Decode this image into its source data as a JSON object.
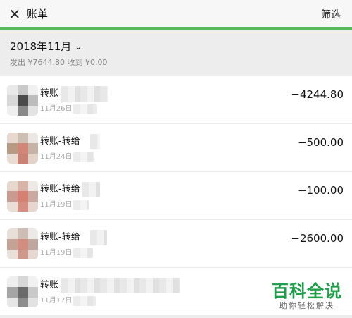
{
  "header": {
    "close_icon": "close-icon",
    "title": "账单",
    "filter_label": "筛选"
  },
  "summary": {
    "month": "2018年11月",
    "dropdown_icon": "chevron-down-icon",
    "totals": "发出 ¥7644.80 收到 ¥0.00"
  },
  "transactions": [
    {
      "name": "转账",
      "date": "11月26日",
      "amount": "−4244.80"
    },
    {
      "name": "转账-转给",
      "date": "11月24日",
      "amount": "−500.00"
    },
    {
      "name": "转账-转给",
      "date": "11月19日",
      "amount": "−100.00"
    },
    {
      "name": "转账-转给",
      "date": "11月19日",
      "amount": "−2600.00"
    },
    {
      "name": "转账",
      "date": "11月17日",
      "amount": ""
    }
  ],
  "watermark": {
    "logo_text": "百科全说",
    "sub_text": "助你轻松解决"
  },
  "colors": {
    "accent": "#5ab95a",
    "watermark": "#1e9e4a"
  }
}
